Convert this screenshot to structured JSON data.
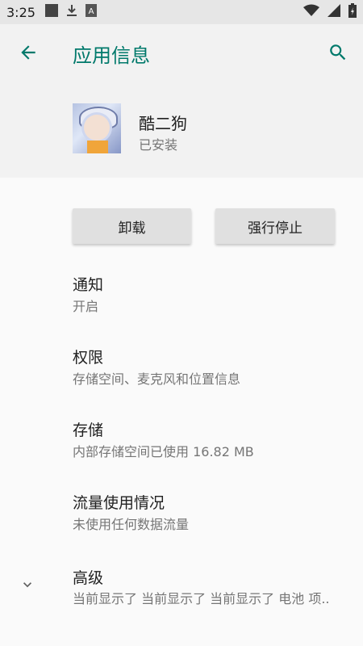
{
  "status_bar": {
    "time": "3:25",
    "left_icons": [
      "square-notification-icon",
      "download-icon",
      "a-notification-icon"
    ],
    "right_icons": [
      "wifi-icon",
      "signal-icon",
      "battery-icon"
    ]
  },
  "app_bar": {
    "title": "应用信息",
    "back_icon": "arrow-back-icon",
    "search_icon": "search-icon",
    "accent_color": "#00796b"
  },
  "app": {
    "name": "酷二狗",
    "status": "已安装"
  },
  "buttons": {
    "uninstall": "卸载",
    "force_stop": "强行停止"
  },
  "preferences": [
    {
      "title": "通知",
      "summary": "开启"
    },
    {
      "title": "权限",
      "summary": "存储空间、麦克风和位置信息"
    },
    {
      "title": "存储",
      "summary": "内部存储空间已使用 16.82 MB"
    },
    {
      "title": "流量使用情况",
      "summary": "未使用任何数据流量"
    }
  ],
  "advanced": {
    "title": "高级",
    "summary": "当前显示了 当前显示了 当前显示了 电池 项..",
    "icon": "chevron-down-icon"
  }
}
